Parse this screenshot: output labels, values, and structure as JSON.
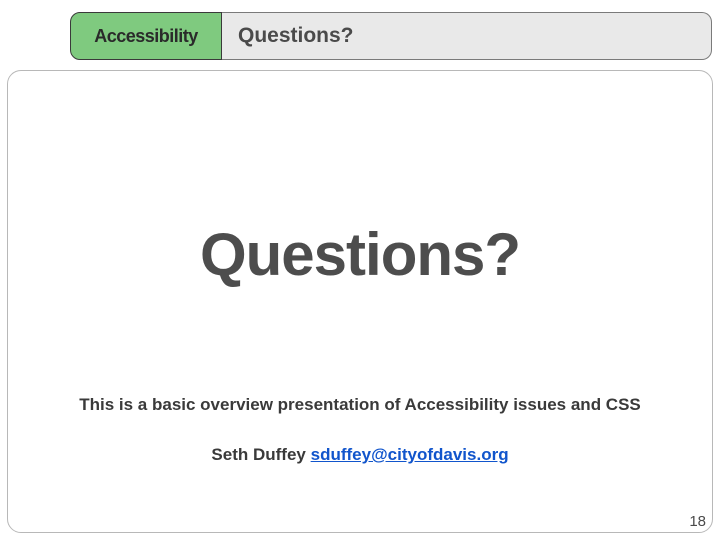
{
  "header": {
    "tab_label": "Accessibility",
    "title": "Questions?"
  },
  "main": {
    "heading": "Questions?",
    "description": "This is a basic overview presentation of Accessibility issues and CSS",
    "author_name": "Seth Duffey",
    "author_email": "sduffey@cityofdavis.org",
    "author_email_href": "mailto:sduffey@cityofdavis.org"
  },
  "page_number": "18"
}
